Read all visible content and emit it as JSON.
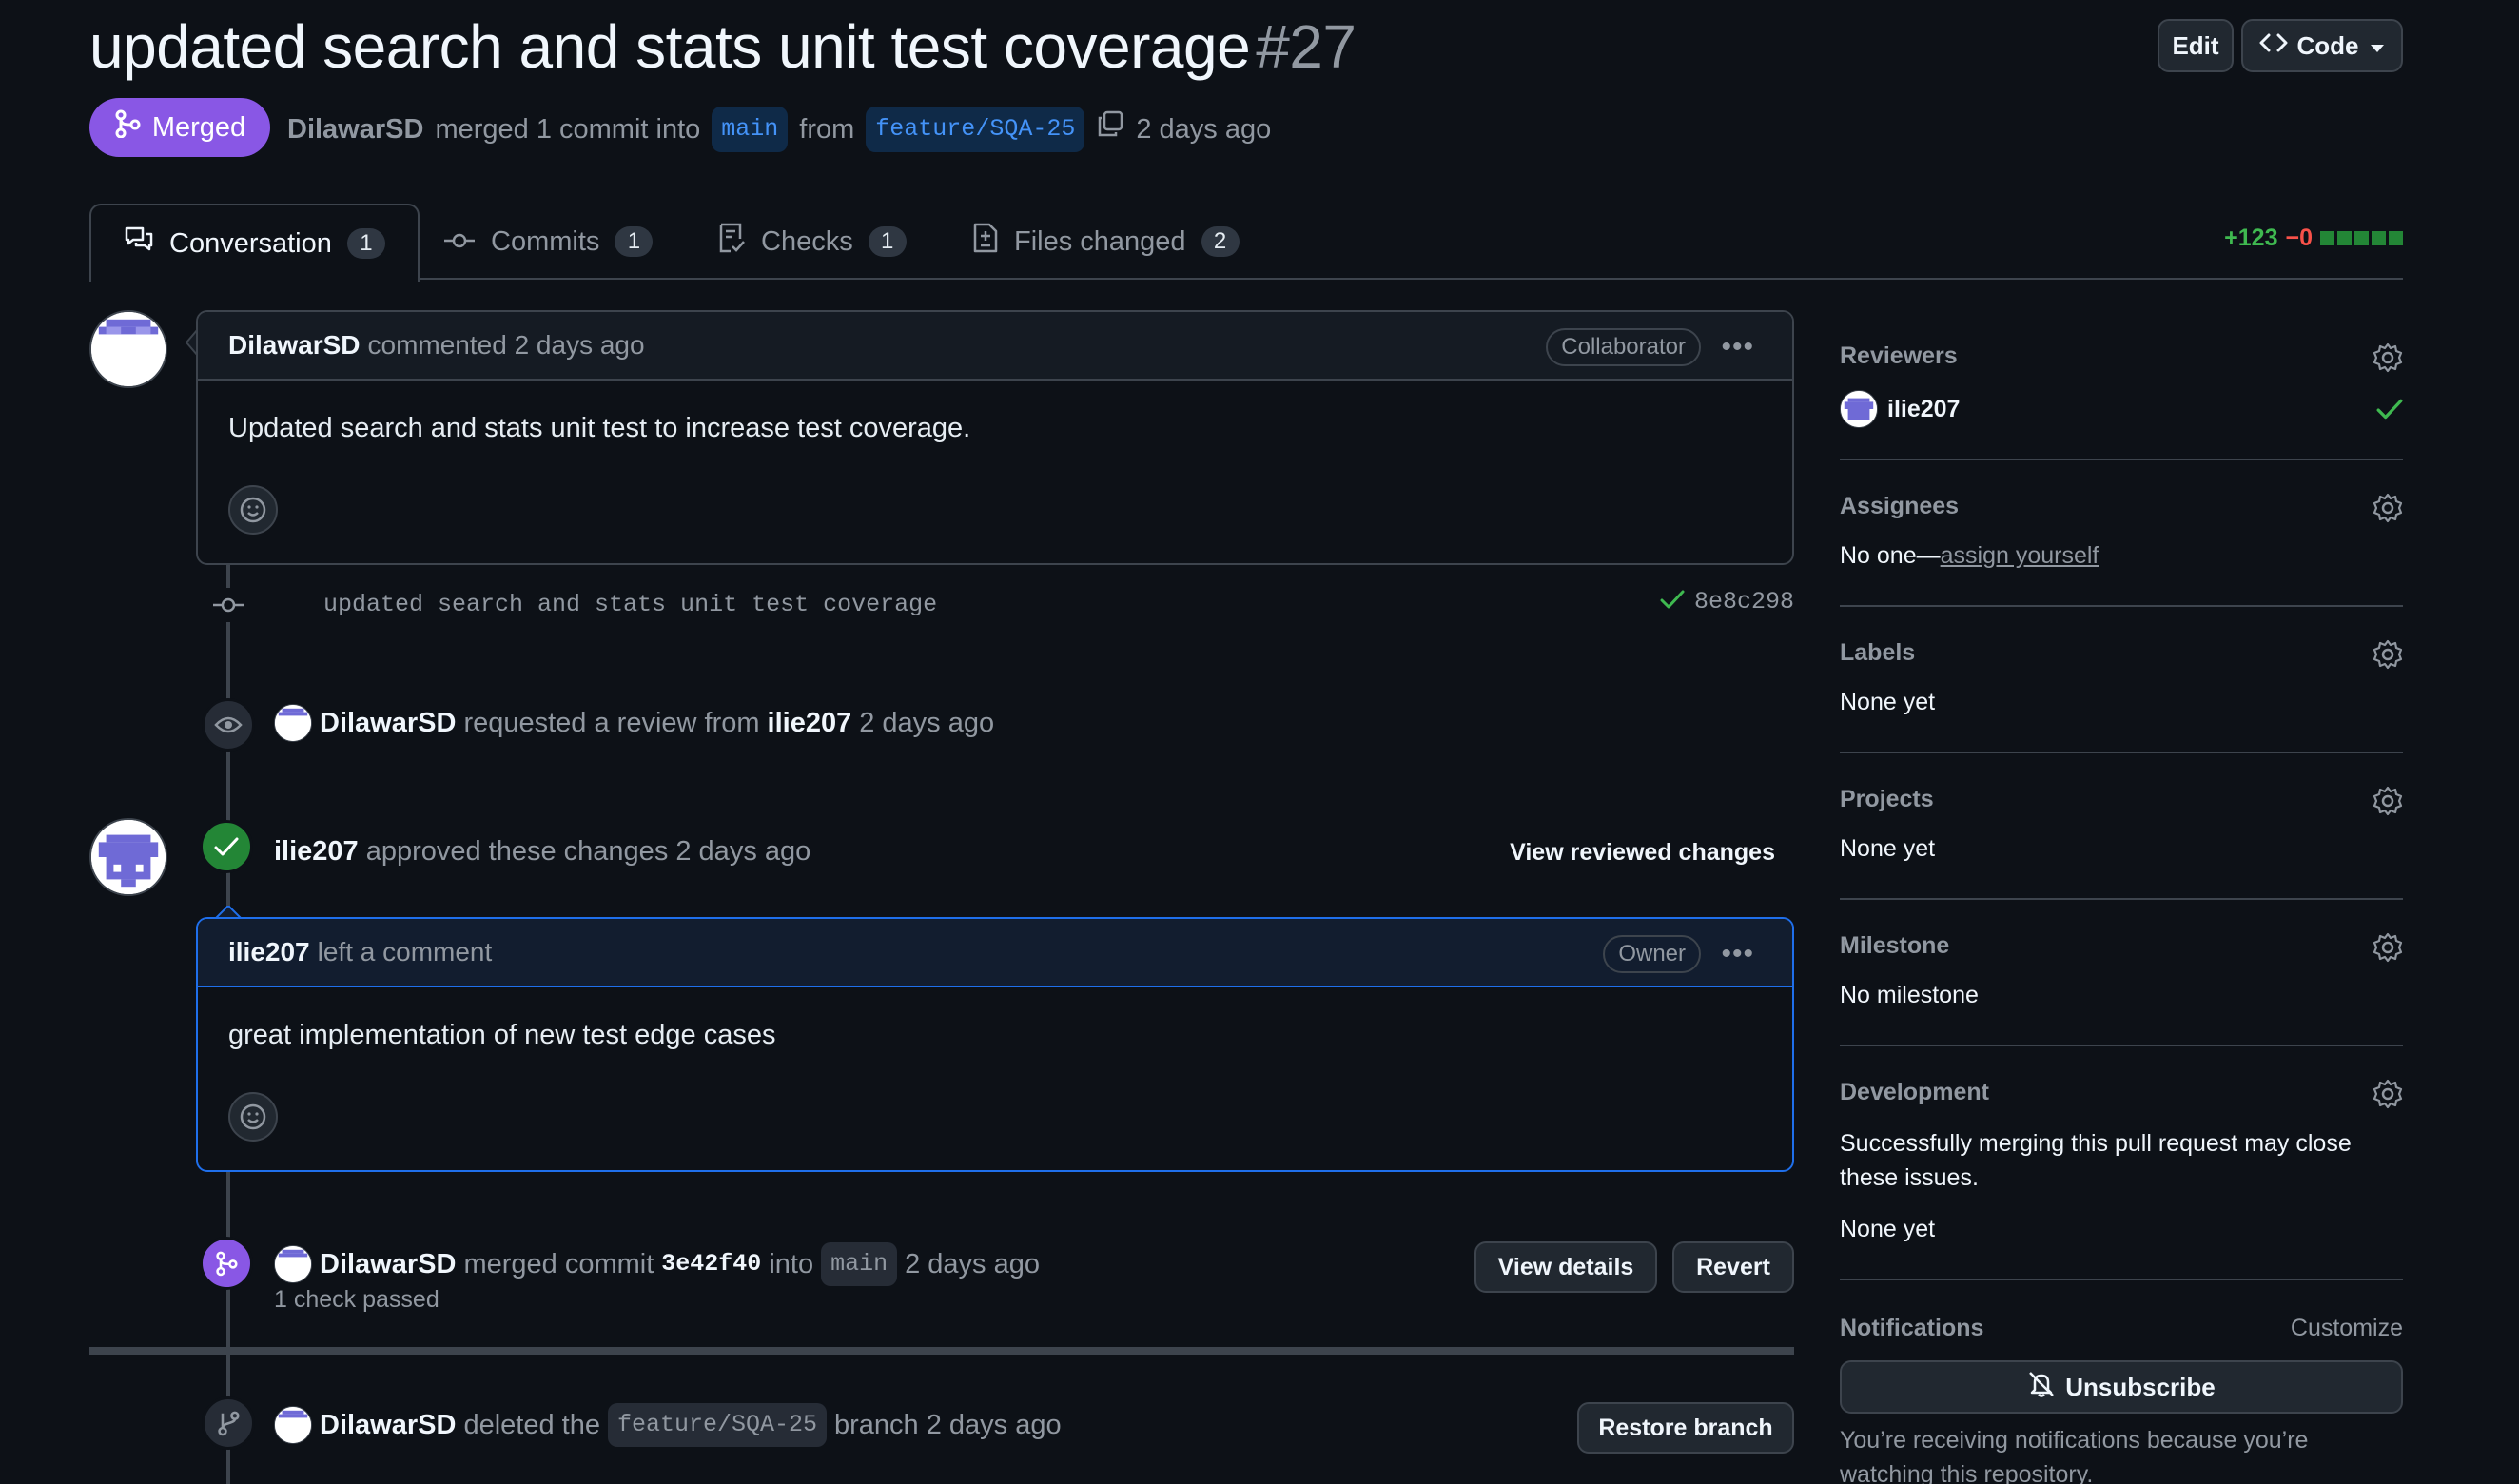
{
  "header": {
    "title": "updated search and stats unit test coverage",
    "number": "#27",
    "edit_label": "Edit",
    "code_label": "Code"
  },
  "status": {
    "badge": "Merged",
    "author": "DilawarSD",
    "merged_text": "merged 1 commit into",
    "base_branch": "main",
    "from_text": "from",
    "head_branch": "feature/SQA-25",
    "time": "2 days ago"
  },
  "tabs": [
    {
      "label": "Conversation",
      "count": "1"
    },
    {
      "label": "Commits",
      "count": "1"
    },
    {
      "label": "Checks",
      "count": "1"
    },
    {
      "label": "Files changed",
      "count": "2"
    }
  ],
  "diffstat": {
    "additions": "+123",
    "deletions": "−0"
  },
  "timeline": {
    "comment1": {
      "author": "DilawarSD",
      "action": "commented 2 days ago",
      "role": "Collaborator",
      "body": "Updated search and stats unit test to increase test coverage."
    },
    "commit": {
      "message": "updated search and stats unit test coverage",
      "sha": "8e8c298"
    },
    "review_request": {
      "actor": "DilawarSD",
      "text": "requested a review from",
      "reviewer": "ilie207",
      "time": "2 days ago"
    },
    "approval": {
      "actor": "ilie207",
      "text": "approved these changes 2 days ago",
      "view_label": "View reviewed changes"
    },
    "comment2": {
      "author": "ilie207",
      "action": "left a comment",
      "role": "Owner",
      "body": "great implementation of new test edge cases"
    },
    "merge": {
      "actor": "DilawarSD",
      "text": "merged commit",
      "sha": "3e42f40",
      "into": "into",
      "branch": "main",
      "time": "2 days ago",
      "checks": "1 check passed",
      "details_label": "View details",
      "revert_label": "Revert"
    },
    "delete": {
      "actor": "DilawarSD",
      "text": "deleted the",
      "branch": "feature/SQA-25",
      "suffix": "branch 2 days ago",
      "restore_label": "Restore branch"
    }
  },
  "sidebar": {
    "reviewers": {
      "label": "Reviewers",
      "name": "ilie207"
    },
    "assignees": {
      "label": "Assignees",
      "value_prefix": "No one—",
      "assign_link": "assign yourself"
    },
    "labels": {
      "label": "Labels",
      "value": "None yet"
    },
    "projects": {
      "label": "Projects",
      "value": "None yet"
    },
    "milestone": {
      "label": "Milestone",
      "value": "No milestone"
    },
    "development": {
      "label": "Development",
      "description": "Successfully merging this pull request may close these issues.",
      "value": "None yet"
    },
    "notifications": {
      "label": "Notifications",
      "customize": "Customize",
      "unsubscribe": "Unsubscribe",
      "reason": "You’re receiving notifications because you’re watching this repository."
    }
  },
  "colors": {
    "merged": "#8957e5",
    "approved": "#238636",
    "link": "#4493f8",
    "background": "#0d1117"
  }
}
